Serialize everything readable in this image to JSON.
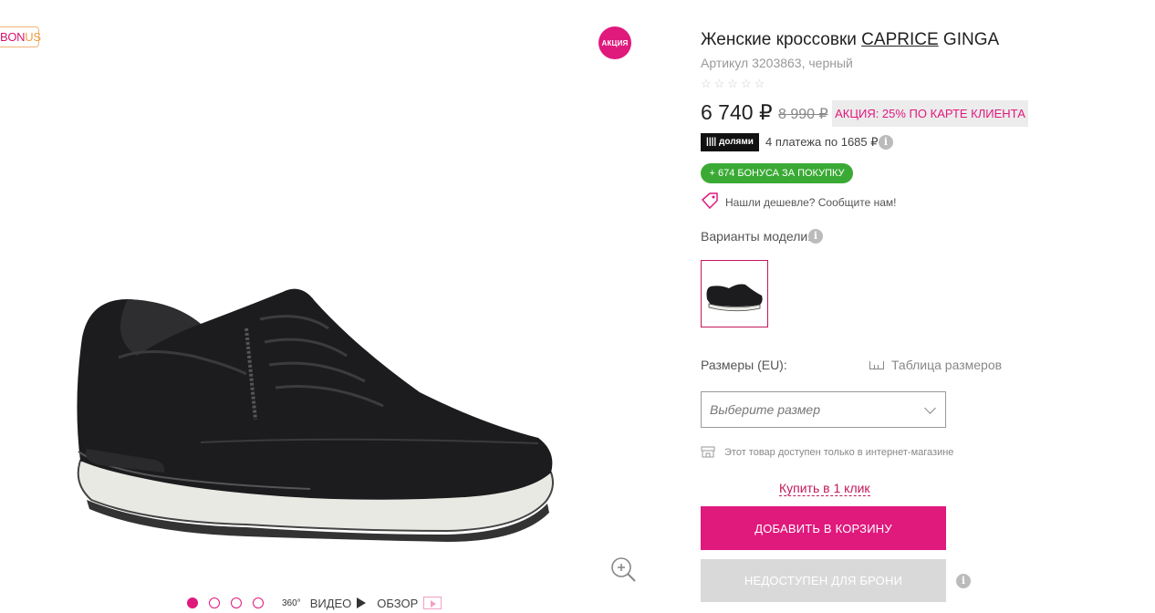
{
  "badges": {
    "bonus_prefix": "BON",
    "bonus_suffix": "US",
    "promo": "АКЦИЯ"
  },
  "gallery": {
    "dots_count": 4,
    "active_dot": 1,
    "label_360": "360°",
    "video": "ВИДЕО",
    "review": "ОБЗОР"
  },
  "product": {
    "title_prefix": "Женские кроссовки ",
    "brand": "CAPRICE",
    "model": " GINGA",
    "article": "Артикул 3203863, черный",
    "stars": "☆☆☆☆☆",
    "price": "6 740 ₽",
    "old_price": "8 990 ₽",
    "promo_label": "АКЦИЯ: 25% ПО КАРТЕ КЛИЕНТА",
    "dolyami_logo": "|||| долями",
    "installments": "4 платежа по 1685 ₽",
    "bonus_pill": "+ 674 БОНУСА ЗА ПОКУПКУ",
    "cheaper": "Нашли дешевле? Сообщите нам!",
    "variants_label": "Варианты модели:",
    "sizes_label": "Размеры (EU):",
    "size_table": "Таблица размеров",
    "size_placeholder": "Выберите размер",
    "online_only": "Этот товар доступен только в интернет-магазине",
    "one_click": "Купить в 1 клик",
    "add_to_cart": "ДОБАВИТЬ В КОРЗИНУ",
    "not_reserve": "НЕДОСТУПЕН ДЛЯ БРОНИ"
  },
  "icons": {
    "info": "info-icon",
    "zoom": "zoom-in-icon",
    "tag": "price-tag-icon",
    "ruler": "ruler-icon",
    "store": "store-icon"
  },
  "colors": {
    "accent": "#e0197d",
    "bonus_green": "#3aaa35",
    "promo_bg": "#ececec",
    "disabled": "#d9d9d9"
  }
}
